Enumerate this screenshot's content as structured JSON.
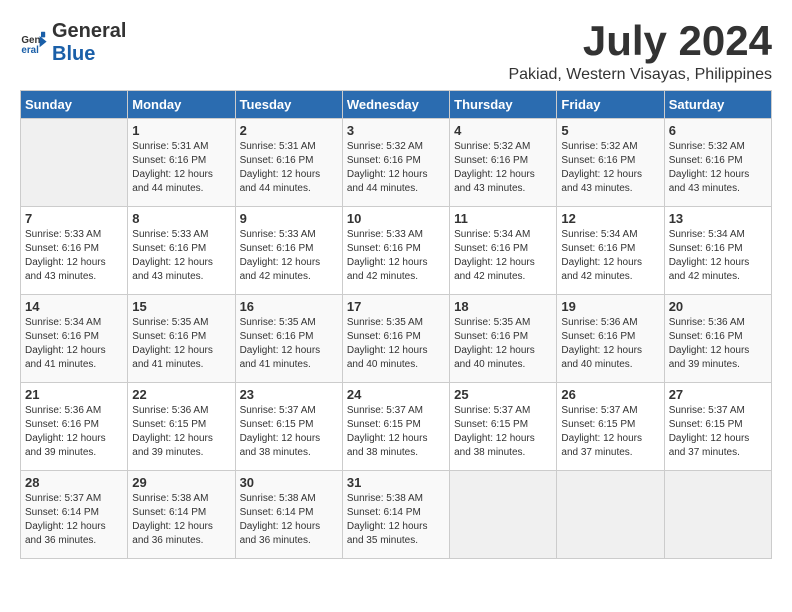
{
  "header": {
    "logo_general": "General",
    "logo_blue": "Blue",
    "month_year": "July 2024",
    "location": "Pakiad, Western Visayas, Philippines"
  },
  "weekdays": [
    "Sunday",
    "Monday",
    "Tuesday",
    "Wednesday",
    "Thursday",
    "Friday",
    "Saturday"
  ],
  "weeks": [
    [
      {
        "day": "",
        "info": ""
      },
      {
        "day": "1",
        "info": "Sunrise: 5:31 AM\nSunset: 6:16 PM\nDaylight: 12 hours\nand 44 minutes."
      },
      {
        "day": "2",
        "info": "Sunrise: 5:31 AM\nSunset: 6:16 PM\nDaylight: 12 hours\nand 44 minutes."
      },
      {
        "day": "3",
        "info": "Sunrise: 5:32 AM\nSunset: 6:16 PM\nDaylight: 12 hours\nand 44 minutes."
      },
      {
        "day": "4",
        "info": "Sunrise: 5:32 AM\nSunset: 6:16 PM\nDaylight: 12 hours\nand 43 minutes."
      },
      {
        "day": "5",
        "info": "Sunrise: 5:32 AM\nSunset: 6:16 PM\nDaylight: 12 hours\nand 43 minutes."
      },
      {
        "day": "6",
        "info": "Sunrise: 5:32 AM\nSunset: 6:16 PM\nDaylight: 12 hours\nand 43 minutes."
      }
    ],
    [
      {
        "day": "7",
        "info": "Sunrise: 5:33 AM\nSunset: 6:16 PM\nDaylight: 12 hours\nand 43 minutes."
      },
      {
        "day": "8",
        "info": "Sunrise: 5:33 AM\nSunset: 6:16 PM\nDaylight: 12 hours\nand 43 minutes."
      },
      {
        "day": "9",
        "info": "Sunrise: 5:33 AM\nSunset: 6:16 PM\nDaylight: 12 hours\nand 42 minutes."
      },
      {
        "day": "10",
        "info": "Sunrise: 5:33 AM\nSunset: 6:16 PM\nDaylight: 12 hours\nand 42 minutes."
      },
      {
        "day": "11",
        "info": "Sunrise: 5:34 AM\nSunset: 6:16 PM\nDaylight: 12 hours\nand 42 minutes."
      },
      {
        "day": "12",
        "info": "Sunrise: 5:34 AM\nSunset: 6:16 PM\nDaylight: 12 hours\nand 42 minutes."
      },
      {
        "day": "13",
        "info": "Sunrise: 5:34 AM\nSunset: 6:16 PM\nDaylight: 12 hours\nand 42 minutes."
      }
    ],
    [
      {
        "day": "14",
        "info": "Sunrise: 5:34 AM\nSunset: 6:16 PM\nDaylight: 12 hours\nand 41 minutes."
      },
      {
        "day": "15",
        "info": "Sunrise: 5:35 AM\nSunset: 6:16 PM\nDaylight: 12 hours\nand 41 minutes."
      },
      {
        "day": "16",
        "info": "Sunrise: 5:35 AM\nSunset: 6:16 PM\nDaylight: 12 hours\nand 41 minutes."
      },
      {
        "day": "17",
        "info": "Sunrise: 5:35 AM\nSunset: 6:16 PM\nDaylight: 12 hours\nand 40 minutes."
      },
      {
        "day": "18",
        "info": "Sunrise: 5:35 AM\nSunset: 6:16 PM\nDaylight: 12 hours\nand 40 minutes."
      },
      {
        "day": "19",
        "info": "Sunrise: 5:36 AM\nSunset: 6:16 PM\nDaylight: 12 hours\nand 40 minutes."
      },
      {
        "day": "20",
        "info": "Sunrise: 5:36 AM\nSunset: 6:16 PM\nDaylight: 12 hours\nand 39 minutes."
      }
    ],
    [
      {
        "day": "21",
        "info": "Sunrise: 5:36 AM\nSunset: 6:16 PM\nDaylight: 12 hours\nand 39 minutes."
      },
      {
        "day": "22",
        "info": "Sunrise: 5:36 AM\nSunset: 6:15 PM\nDaylight: 12 hours\nand 39 minutes."
      },
      {
        "day": "23",
        "info": "Sunrise: 5:37 AM\nSunset: 6:15 PM\nDaylight: 12 hours\nand 38 minutes."
      },
      {
        "day": "24",
        "info": "Sunrise: 5:37 AM\nSunset: 6:15 PM\nDaylight: 12 hours\nand 38 minutes."
      },
      {
        "day": "25",
        "info": "Sunrise: 5:37 AM\nSunset: 6:15 PM\nDaylight: 12 hours\nand 38 minutes."
      },
      {
        "day": "26",
        "info": "Sunrise: 5:37 AM\nSunset: 6:15 PM\nDaylight: 12 hours\nand 37 minutes."
      },
      {
        "day": "27",
        "info": "Sunrise: 5:37 AM\nSunset: 6:15 PM\nDaylight: 12 hours\nand 37 minutes."
      }
    ],
    [
      {
        "day": "28",
        "info": "Sunrise: 5:37 AM\nSunset: 6:14 PM\nDaylight: 12 hours\nand 36 minutes."
      },
      {
        "day": "29",
        "info": "Sunrise: 5:38 AM\nSunset: 6:14 PM\nDaylight: 12 hours\nand 36 minutes."
      },
      {
        "day": "30",
        "info": "Sunrise: 5:38 AM\nSunset: 6:14 PM\nDaylight: 12 hours\nand 36 minutes."
      },
      {
        "day": "31",
        "info": "Sunrise: 5:38 AM\nSunset: 6:14 PM\nDaylight: 12 hours\nand 35 minutes."
      },
      {
        "day": "",
        "info": ""
      },
      {
        "day": "",
        "info": ""
      },
      {
        "day": "",
        "info": ""
      }
    ]
  ]
}
